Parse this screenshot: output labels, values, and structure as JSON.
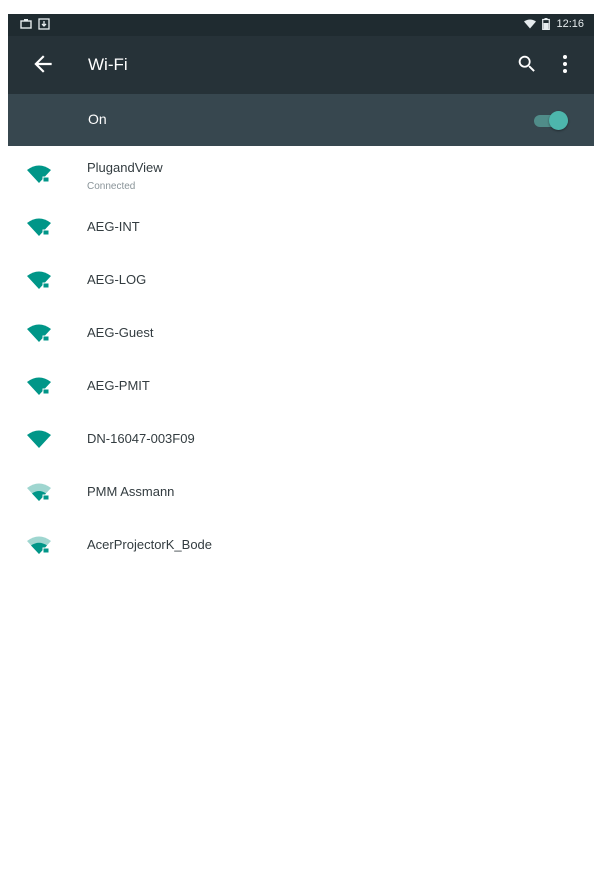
{
  "status_bar": {
    "time": "12:16",
    "icons": [
      "screenshot-icon",
      "download-icon",
      "wifi-signal-icon",
      "battery-icon"
    ]
  },
  "toolbar": {
    "title": "Wi-Fi",
    "back_icon": "arrow-back-icon",
    "search_icon": "search-icon",
    "more_icon": "more-vert-icon"
  },
  "master_switch": {
    "label": "On",
    "state": "on"
  },
  "colors": {
    "accent": "#009688",
    "toolbar": "#263238",
    "switchbar": "#37474f"
  },
  "networks": [
    {
      "name": "PlugandView",
      "status": "Connected",
      "secured": true
    },
    {
      "name": "AEG-INT",
      "secured": true
    },
    {
      "name": "AEG-LOG",
      "secured": true
    },
    {
      "name": "AEG-Guest",
      "secured": true
    },
    {
      "name": "AEG-PMIT",
      "secured": true
    },
    {
      "name": "DN-16047-003F09",
      "secured": false
    },
    {
      "name": "PMM Assmann",
      "secured": true
    },
    {
      "name": "AcerProjectorK_Bode",
      "secured": true
    }
  ]
}
